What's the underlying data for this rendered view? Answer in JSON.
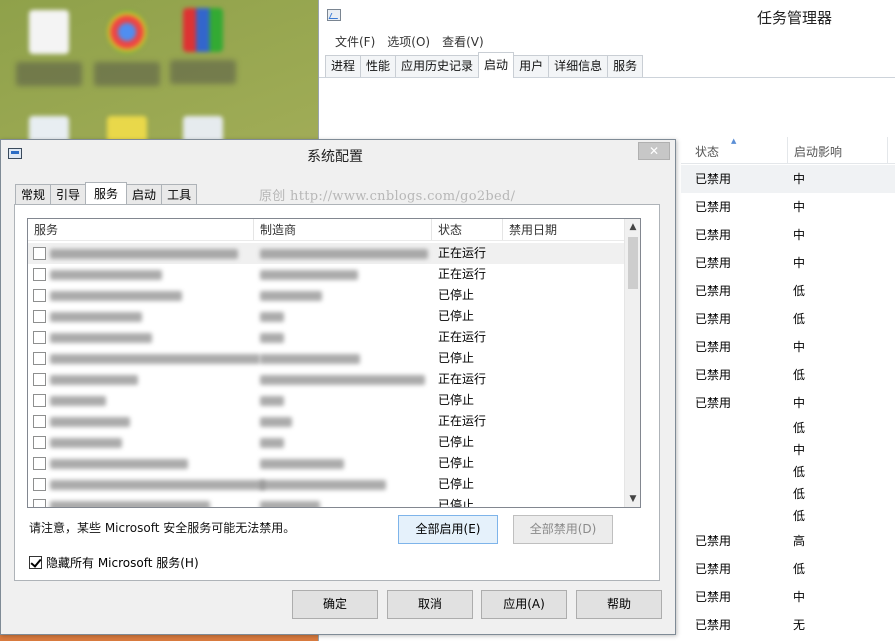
{
  "task_manager": {
    "title": "任务管理器",
    "menu": [
      "文件(F)",
      "选项(O)",
      "查看(V)"
    ],
    "tabs": [
      "进程",
      "性能",
      "应用历史记录",
      "启动",
      "用户",
      "详细信息",
      "服务"
    ],
    "active_tab": "启动",
    "columns": {
      "status": "状态",
      "impact": "启动影响"
    },
    "rows": [
      {
        "status": "已禁用",
        "impact": "中"
      },
      {
        "status": "已禁用",
        "impact": "中"
      },
      {
        "status": "已禁用",
        "impact": "中"
      },
      {
        "status": "已禁用",
        "impact": "中"
      },
      {
        "status": "已禁用",
        "impact": "低"
      },
      {
        "status": "已禁用",
        "impact": "低"
      },
      {
        "status": "已禁用",
        "impact": "中"
      },
      {
        "status": "已禁用",
        "impact": "低"
      },
      {
        "status": "已禁用",
        "impact": "中"
      },
      {
        "status": "",
        "impact": "低"
      },
      {
        "status": "",
        "impact": "中"
      },
      {
        "status": "",
        "impact": "低"
      },
      {
        "status": "",
        "impact": "低"
      },
      {
        "status": "",
        "impact": "低"
      },
      {
        "status": "已禁用",
        "impact": "高"
      },
      {
        "status": "已禁用",
        "impact": "低"
      },
      {
        "status": "已禁用",
        "impact": "中"
      },
      {
        "status": "已禁用",
        "impact": "无"
      }
    ]
  },
  "msconfig": {
    "title": "系统配置",
    "close": "✕",
    "tabs": [
      "常规",
      "引导",
      "服务",
      "启动",
      "工具"
    ],
    "active_tab": "服务",
    "watermark": "原创 http://www.cnblogs.com/go2bed/",
    "columns": [
      "服务",
      "制造商",
      "状态",
      "禁用日期"
    ],
    "services": [
      {
        "status": "正在运行"
      },
      {
        "status": "正在运行"
      },
      {
        "status": "已停止"
      },
      {
        "status": "已停止"
      },
      {
        "status": "正在运行"
      },
      {
        "status": "已停止"
      },
      {
        "status": "正在运行"
      },
      {
        "status": "已停止"
      },
      {
        "status": "正在运行"
      },
      {
        "status": "已停止"
      },
      {
        "status": "已停止"
      },
      {
        "status": "已停止"
      },
      {
        "status": "已停止"
      }
    ],
    "notice": "请注意，某些 Microsoft 安全服务可能无法禁用。",
    "enable_all": "全部启用(E)",
    "disable_all": "全部禁用(D)",
    "hide_ms": "隐藏所有 Microsoft 服务(H)",
    "hide_ms_checked": true,
    "buttons": {
      "ok": "确定",
      "cancel": "取消",
      "apply": "应用(A)",
      "help": "帮助"
    }
  }
}
